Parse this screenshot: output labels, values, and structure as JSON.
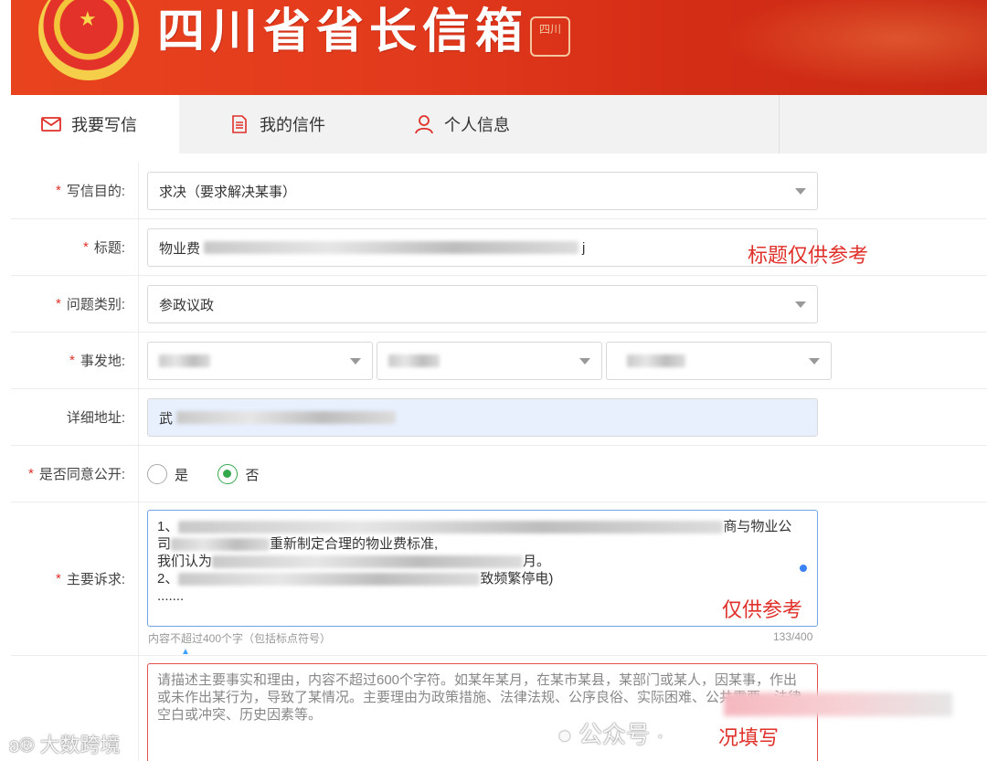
{
  "banner": {
    "title": "四川省省长信箱",
    "seal_text": "四川"
  },
  "tabs": [
    {
      "label": "我要写信",
      "icon": "mail-icon"
    },
    {
      "label": "我的信件",
      "icon": "document-list-icon"
    },
    {
      "label": "个人信息",
      "icon": "user-icon"
    }
  ],
  "form": {
    "purpose": {
      "label": "写信目的:",
      "value": "求决（要求解决某事）"
    },
    "title": {
      "label": "标题:",
      "value_prefix": "物业费",
      "value_suffix": "j",
      "note": "标题仅供参考"
    },
    "category": {
      "label": "问题类别:",
      "value": "参政议政"
    },
    "location": {
      "label": "事发地:"
    },
    "address": {
      "label": "详细地址:",
      "value_prefix": "武"
    },
    "public": {
      "label": "是否同意公开:",
      "yes": "是",
      "no": "否"
    },
    "appeal": {
      "label": "主要诉求:",
      "line1_prefix": "1、",
      "line1_suffix": "商与物业公",
      "line2_prefix": "司",
      "line2_mid": "重新制定合理的物业费标准,",
      "line3_prefix": "我们认为",
      "line3_suffix": "月。",
      "line4_prefix": "2、",
      "line4_suffix": "致频繁停电)",
      "line5": ".......",
      "hint": "内容不超过400个字（包括标点符号）",
      "count": "133/400",
      "note": "仅供参考"
    },
    "facts": {
      "placeholder": "请描述主要事实和理由，内容不超过600个字符。如某年某月，在某市某县，某部门或某人，因某事，作出或未作出某行为，导致了某情况。主要理由为政策措施、法律法规、公序良俗、实际困难、公共需要、法律空白或冲突、历史因素等。",
      "note": "况填写"
    }
  },
  "watermarks": {
    "left": "大数跨境",
    "right": "公众号 ·"
  },
  "colors": {
    "banner_red": "#e23a1c",
    "required": "#e0302a",
    "radio_green": "#35a84e",
    "focus_blue": "#6ea4e8"
  }
}
